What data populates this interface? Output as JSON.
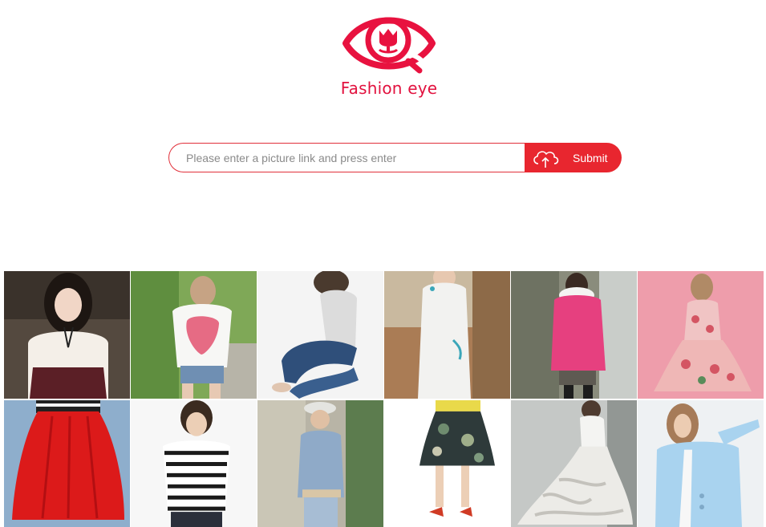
{
  "brand": {
    "name": "Fashion eye",
    "color": "#e2123f"
  },
  "search": {
    "placeholder": "Please enter a picture link and press enter",
    "value": "",
    "submit_label": "Submit",
    "submit_icon": "cloud-upload-icon",
    "accent": "#e8262f"
  },
  "gallery": {
    "items": [
      {
        "subject": "white blouse with bow and plaid skirt"
      },
      {
        "subject": "white tee with pink strawberry print and denim shorts"
      },
      {
        "subject": "grey tank top and skinny jeans"
      },
      {
        "subject": "white qipao dress"
      },
      {
        "subject": "pink quilted down jacket with fur collar"
      },
      {
        "subject": "pink floral sleeveless dress"
      },
      {
        "subject": "red pleated midi skirt"
      },
      {
        "subject": "black and white striped tee"
      },
      {
        "subject": "sleeveless denim shirt with cap"
      },
      {
        "subject": "dark floral print midi skirt"
      },
      {
        "subject": "white ruffled wedding gown"
      },
      {
        "subject": "light blue blazer"
      }
    ]
  }
}
